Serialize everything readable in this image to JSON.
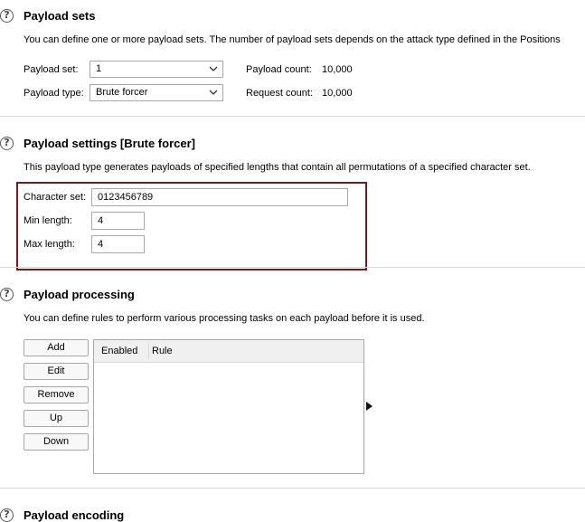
{
  "payload_sets": {
    "title": "Payload sets",
    "description": "You can define one or more payload sets. The number of payload sets depends on the attack type defined in the Positions",
    "set_label": "Payload set:",
    "set_value": "1",
    "type_label": "Payload type:",
    "type_value": "Brute forcer",
    "count_label": "Payload count:",
    "count_value": "10,000",
    "request_label": "Request count:",
    "request_value": "10,000"
  },
  "payload_settings": {
    "title": "Payload settings [Brute forcer]",
    "description": "This payload type generates payloads of specified lengths that contain all permutations of a specified character set.",
    "charset_label": "Character set:",
    "charset_value": "0123456789",
    "min_label": "Min length:",
    "min_value": "4",
    "max_label": "Max length:",
    "max_value": "4",
    "highlight_color": "#7a1a1f"
  },
  "payload_processing": {
    "title": "Payload processing",
    "description": "You can define rules to perform various processing tasks on each payload before it is used.",
    "buttons": [
      "Add",
      "Edit",
      "Remove",
      "Up",
      "Down"
    ],
    "columns": [
      "Enabled",
      "Rule"
    ],
    "rows": []
  },
  "payload_encoding": {
    "title": "Payload encoding"
  },
  "icons": {
    "help": "help-icon",
    "dropdown": "chevron-down-icon",
    "pointer": "expand-arrow-icon"
  },
  "help_glyph": "?"
}
